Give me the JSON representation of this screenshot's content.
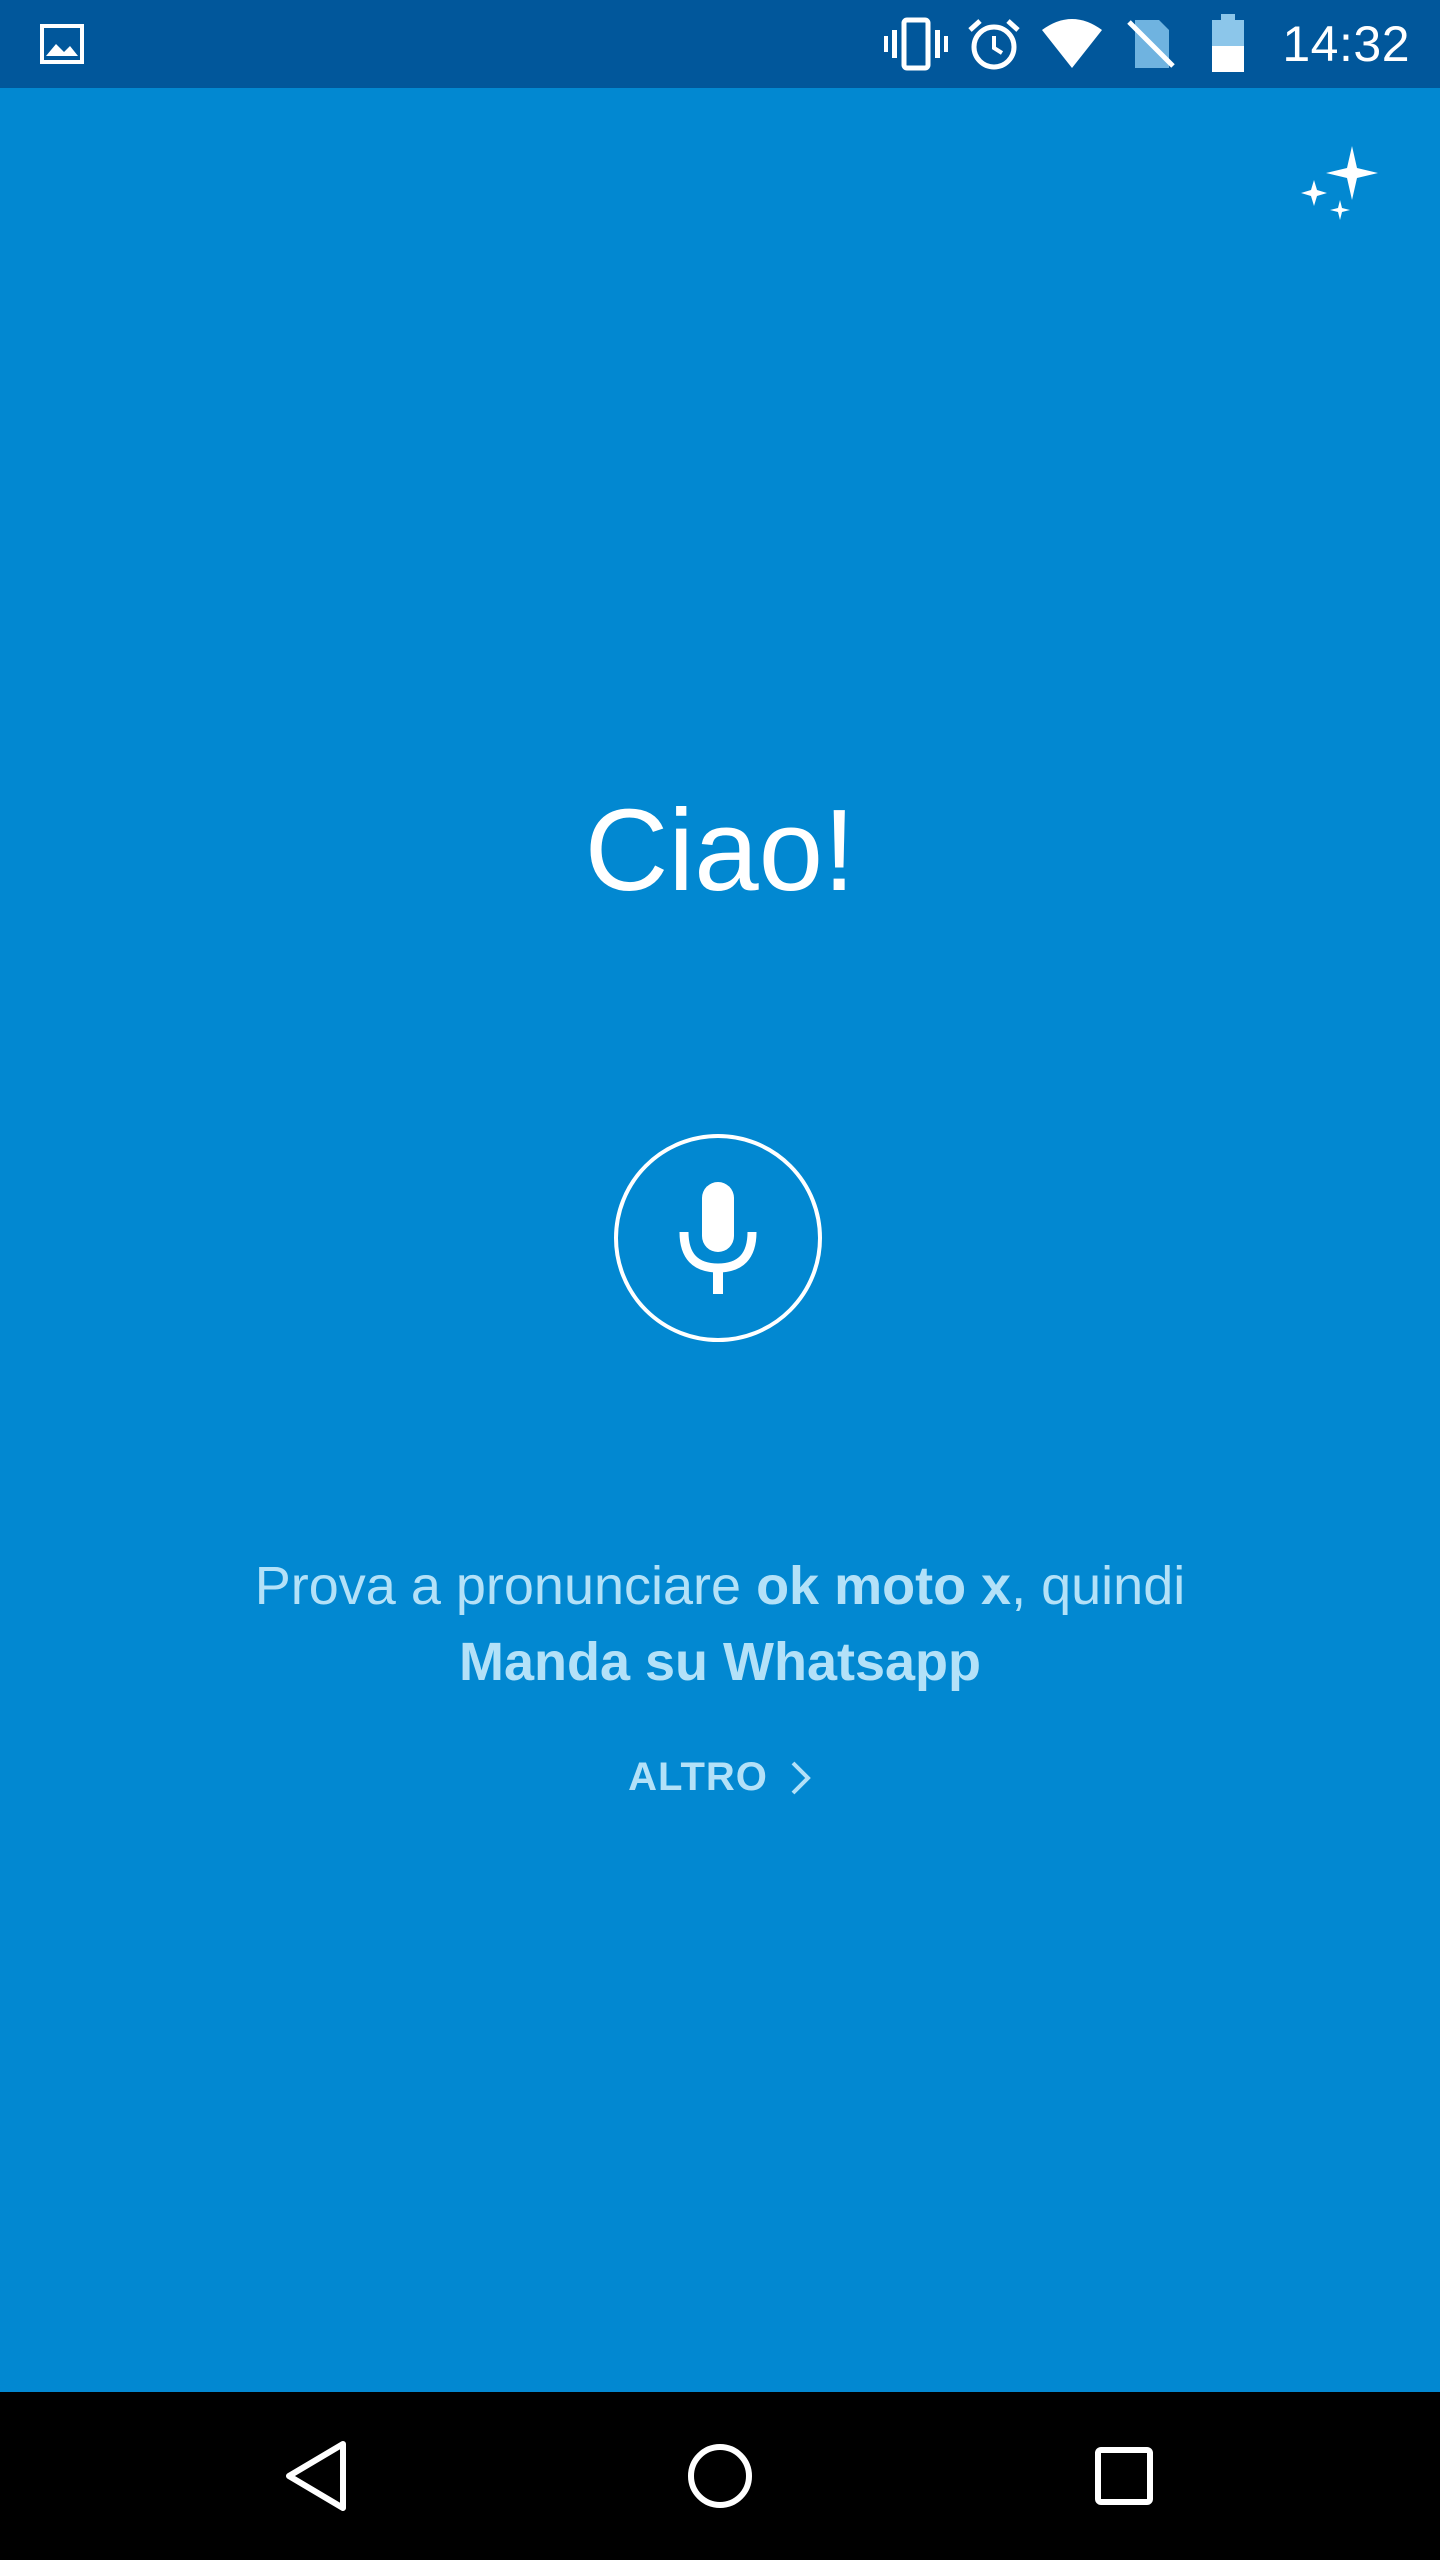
{
  "status_bar": {
    "time": "14:32",
    "icons": [
      "gallery-icon",
      "vibrate-icon",
      "alarm-icon",
      "wifi-icon",
      "no-sim-icon",
      "battery-icon"
    ]
  },
  "main": {
    "greeting": "Ciao!",
    "hint": {
      "prefix": "Prova a pronunciare ",
      "phrase": "ok moto x",
      "middle": ", quindi",
      "command": "Manda su Whatsapp"
    },
    "more_label": "ALTRO"
  },
  "colors": {
    "background": "#0288d1",
    "status_bar": "#01579b",
    "hint_text": "#b3e1f8",
    "nav_bar": "#000000"
  },
  "nav": {
    "icons": [
      "back-icon",
      "home-icon",
      "recent-apps-icon"
    ]
  }
}
